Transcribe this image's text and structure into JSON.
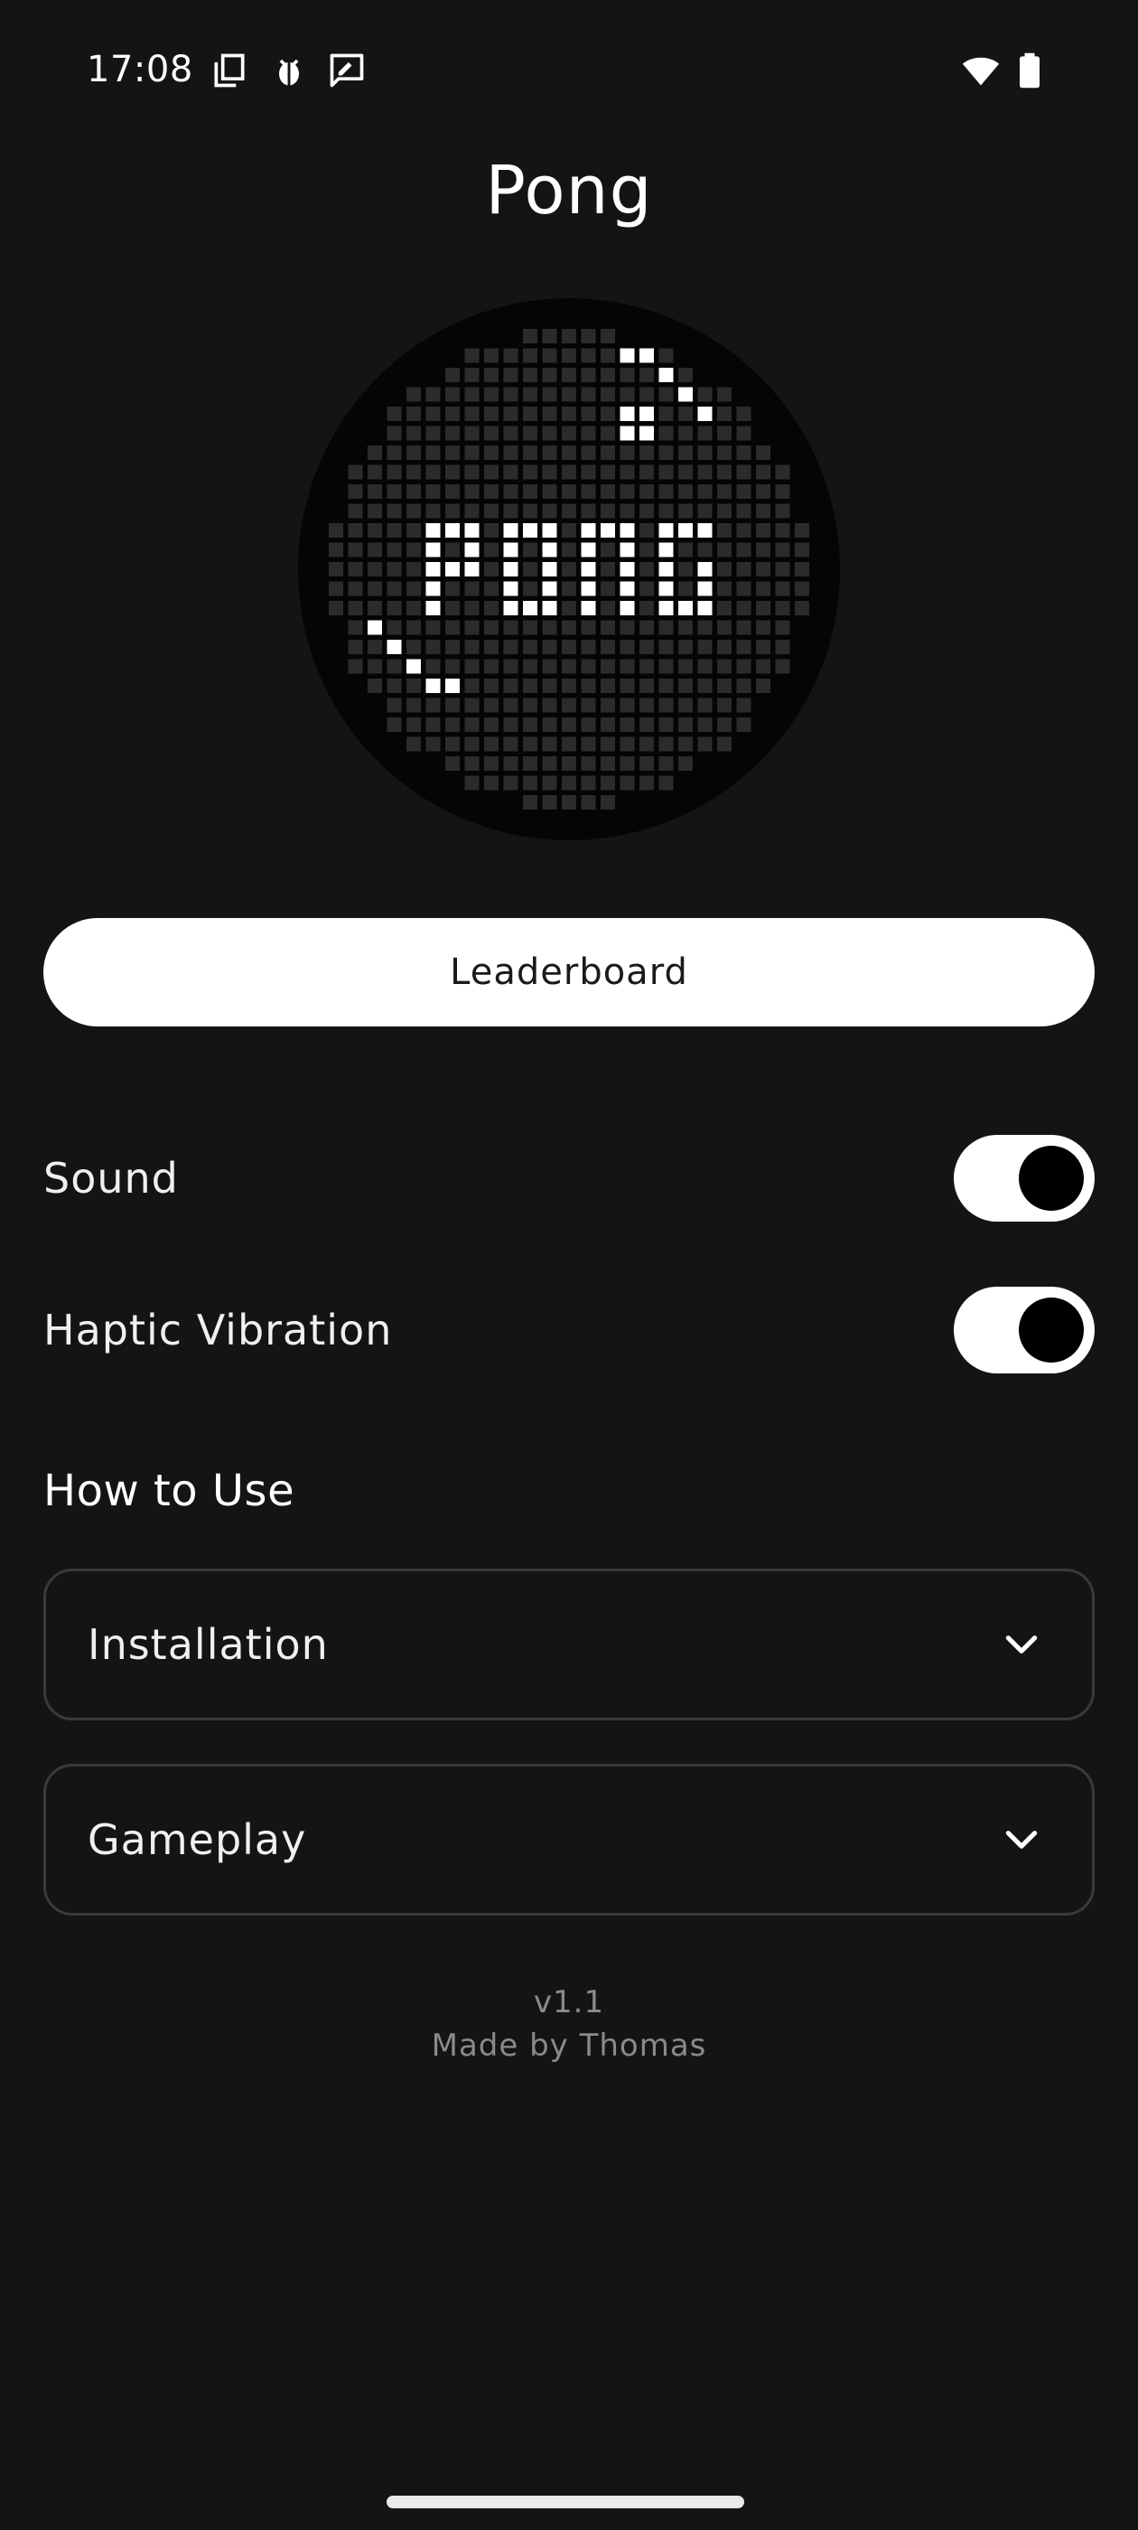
{
  "status_bar": {
    "time": "17:08",
    "icons": [
      "copy-icon",
      "bug-icon",
      "chat-edit-icon"
    ],
    "right_icons": [
      "wifi-icon",
      "battery-icon"
    ]
  },
  "title": "Pong",
  "logo": {
    "icon": "pong-logo-icon",
    "text": "PONG"
  },
  "leaderboard_button": {
    "label": "Leaderboard"
  },
  "settings": {
    "sound": {
      "label": "Sound",
      "enabled": true
    },
    "haptic": {
      "label": "Haptic Vibration",
      "enabled": true
    }
  },
  "how_to_use": {
    "title": "How to Use",
    "items": [
      {
        "label": "Installation",
        "icon": "chevron-down-icon"
      },
      {
        "label": "Gameplay",
        "icon": "chevron-down-icon"
      }
    ]
  },
  "footer": {
    "version": "v1.1",
    "credit": "Made by Thomas"
  },
  "colors": {
    "background": "#141414",
    "button": "#ffffff",
    "toggle_knob": "#000000",
    "border": "#3a3a3a",
    "muted_text": "#8a8a8a"
  }
}
